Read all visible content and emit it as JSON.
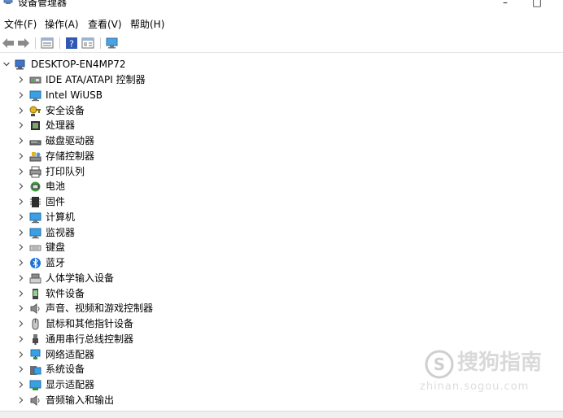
{
  "window": {
    "title": "设备管理器",
    "minimize": "–",
    "maximize": "□"
  },
  "menu": [
    {
      "label": "文件(F)"
    },
    {
      "label": "操作(A)"
    },
    {
      "label": "查看(V)"
    },
    {
      "label": "帮助(H)"
    }
  ],
  "toolbar": {
    "buttons": [
      "back-arrow-icon",
      "forward-arrow-icon",
      "properties-icon",
      "help-icon",
      "view-icon",
      "monitor-scan-icon"
    ]
  },
  "tree": {
    "root": {
      "label": "DESKTOP-EN4MP72",
      "icon": "computer-tree-icon"
    },
    "items": [
      {
        "label": "IDE ATA/ATAPI 控制器",
        "icon": "ide-controller-icon"
      },
      {
        "label": "Intel WiUSB",
        "icon": "monitor-icon"
      },
      {
        "label": "安全设备",
        "icon": "security-key-icon"
      },
      {
        "label": "处理器",
        "icon": "processor-icon"
      },
      {
        "label": "磁盘驱动器",
        "icon": "disk-drive-icon"
      },
      {
        "label": "存储控制器",
        "icon": "storage-controller-icon"
      },
      {
        "label": "打印队列",
        "icon": "printer-icon"
      },
      {
        "label": "电池",
        "icon": "battery-icon"
      },
      {
        "label": "固件",
        "icon": "firmware-icon"
      },
      {
        "label": "计算机",
        "icon": "computer-icon"
      },
      {
        "label": "监视器",
        "icon": "monitor-icon"
      },
      {
        "label": "键盘",
        "icon": "keyboard-icon"
      },
      {
        "label": "蓝牙",
        "icon": "bluetooth-icon"
      },
      {
        "label": "人体学输入设备",
        "icon": "hid-icon"
      },
      {
        "label": "软件设备",
        "icon": "software-device-icon"
      },
      {
        "label": "声音、视频和游戏控制器",
        "icon": "speaker-icon"
      },
      {
        "label": "鼠标和其他指针设备",
        "icon": "mouse-icon"
      },
      {
        "label": "通用串行总线控制器",
        "icon": "usb-icon"
      },
      {
        "label": "网络适配器",
        "icon": "network-adapter-icon"
      },
      {
        "label": "系统设备",
        "icon": "system-device-icon"
      },
      {
        "label": "显示适配器",
        "icon": "display-adapter-icon"
      },
      {
        "label": "音频输入和输出",
        "icon": "speaker-icon"
      }
    ]
  },
  "watermark": {
    "brand": "搜狗指南",
    "url": "zhinan.sogou.com"
  }
}
